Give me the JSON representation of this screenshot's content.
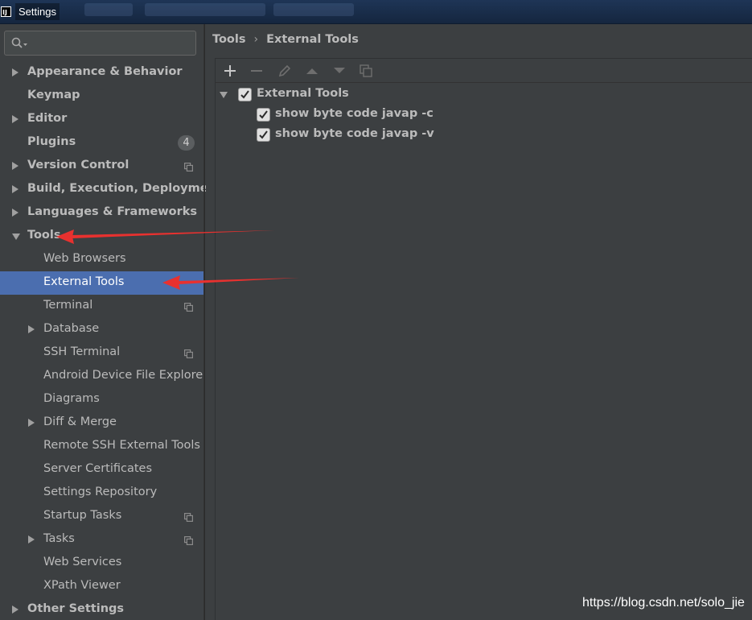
{
  "window": {
    "title": "Settings"
  },
  "search": {
    "value": "",
    "placeholder": ""
  },
  "sidebar": {
    "items": [
      {
        "label": "Appearance & Behavior",
        "bold": true,
        "expander": "collapsed"
      },
      {
        "label": "Keymap",
        "bold": true
      },
      {
        "label": "Editor",
        "bold": true,
        "expander": "collapsed"
      },
      {
        "label": "Plugins",
        "bold": true,
        "badge": "4"
      },
      {
        "label": "Version Control",
        "bold": true,
        "expander": "collapsed",
        "project_icon": "copy-icon"
      },
      {
        "label": "Build, Execution, Deployment",
        "bold": true,
        "expander": "collapsed"
      },
      {
        "label": "Languages & Frameworks",
        "bold": true,
        "expander": "collapsed"
      },
      {
        "label": "Tools",
        "bold": true,
        "expander": "expanded"
      },
      {
        "label": "Web Browsers"
      },
      {
        "label": "External Tools",
        "selected": true
      },
      {
        "label": "Terminal",
        "project_icon": "copy-icon"
      },
      {
        "label": "Database",
        "expander": "collapsed"
      },
      {
        "label": "SSH Terminal",
        "project_icon": "copy-icon"
      },
      {
        "label": "Android Device File Explore"
      },
      {
        "label": "Diagrams"
      },
      {
        "label": "Diff & Merge",
        "expander": "collapsed"
      },
      {
        "label": "Remote SSH External Tools"
      },
      {
        "label": "Server Certificates"
      },
      {
        "label": "Settings Repository"
      },
      {
        "label": "Startup Tasks",
        "project_icon": "copy-icon"
      },
      {
        "label": "Tasks",
        "expander": "collapsed",
        "project_icon": "copy-icon"
      },
      {
        "label": "Web Services"
      },
      {
        "label": "XPath Viewer"
      },
      {
        "label": "Other Settings",
        "bold": true,
        "expander": "collapsed"
      }
    ]
  },
  "breadcrumb": {
    "parent": "Tools",
    "separator": "›",
    "current": "External Tools"
  },
  "toolbar": {
    "buttons": [
      "add-icon",
      "remove-icon",
      "edit-icon",
      "move-up-icon",
      "move-down-icon",
      "copy-icon"
    ]
  },
  "external_tools": {
    "group": {
      "label": "External Tools",
      "checked": true,
      "expanded": true
    },
    "tools": [
      {
        "label": "show byte code javap -c",
        "checked": true
      },
      {
        "label": "show byte code javap -v",
        "checked": true
      }
    ]
  },
  "watermark": "https://blog.csdn.net/solo_jie",
  "colors": {
    "background": "#3c3f41",
    "selection": "#4b6eaf",
    "text": "#bbbbbb",
    "annotation_arrow": "#e8312f"
  }
}
